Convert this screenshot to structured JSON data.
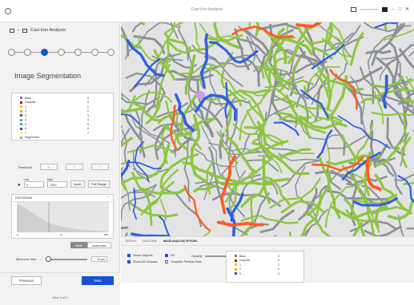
{
  "window": {
    "title": "Cast Iron Analysis",
    "notifications_label": "Screenshots"
  },
  "breadcrumb": {
    "label": "Cast Iron Analysis"
  },
  "stepper": {
    "count": 7,
    "active_index": 2
  },
  "section_title": "Image Segmentation",
  "phase_legend": [
    {
      "label": "Base",
      "value": "0",
      "color": "#7f7f7f"
    },
    {
      "label": "Graphite",
      "value": "0",
      "color": "#c00000"
    },
    {
      "label": "1",
      "value": "1",
      "color": "#ffc000"
    },
    {
      "label": "2",
      "value": "2",
      "color": "#ff9900"
    },
    {
      "label": "3",
      "value": "3",
      "color": "#2f5597"
    },
    {
      "label": "4",
      "value": "4",
      "color": "#70ad47"
    },
    {
      "label": "5",
      "value": "5",
      "color": "#00b0f0"
    },
    {
      "label": "6",
      "value": "6",
      "color": "#7030a0"
    },
    {
      "label": "7",
      "value": "7",
      "color": "#ffff00"
    },
    {
      "label": "Segmented",
      "value": "",
      "color": "#ffffff"
    }
  ],
  "threshold": {
    "label": "Threshold"
  },
  "range": {
    "low_label": "Low",
    "high_label": "High",
    "low_value": "0",
    "high_value": "7000",
    "invert_label": "Invert",
    "full_range_label": "Full Range"
  },
  "histogram": {
    "title": "HISTOGRAM",
    "ticks": [
      "0",
      "32",
      "255"
    ]
  },
  "mode": {
    "options": [
      "Slide",
      "Automatic"
    ],
    "selected": "Slide"
  },
  "min_size": {
    "label": "Minimum Size",
    "value": "20 µm"
  },
  "nav": {
    "previous": "Previous",
    "next": "Next",
    "step_text": "Step 3 of 9"
  },
  "bottom_tabs": [
    "DISPLAY",
    "DATA ZONE",
    "IMAGE ANALYSIS OPTIONS"
  ],
  "bottom_active_tab": "IMAGE ANALYSIS OPTIONS",
  "display_options": {
    "show_objects": "Show Objects",
    "show_all_classes": "Show All Classes",
    "fill": "Fill",
    "graphite_size": "Graphite Particle Size",
    "opacity": "Opacity"
  },
  "bottom_legend": [
    {
      "label": "Base",
      "value": "0",
      "color": "#7f7f7f"
    },
    {
      "label": "Graphite",
      "value": "0",
      "color": "#c00000"
    },
    {
      "label": "1",
      "value": "1",
      "color": "#ffc000"
    },
    {
      "label": "2",
      "value": "2",
      "color": "#ff9900"
    },
    {
      "label": "3",
      "value": "3",
      "color": "#2f5597"
    }
  ],
  "colors": {
    "accent": "#1a4fd6",
    "graphite_green": "#8dc63f",
    "graphite_blue": "#2f5fe0",
    "graphite_orange": "#ff5a1f",
    "graphite_gray": "#8b8f96"
  }
}
